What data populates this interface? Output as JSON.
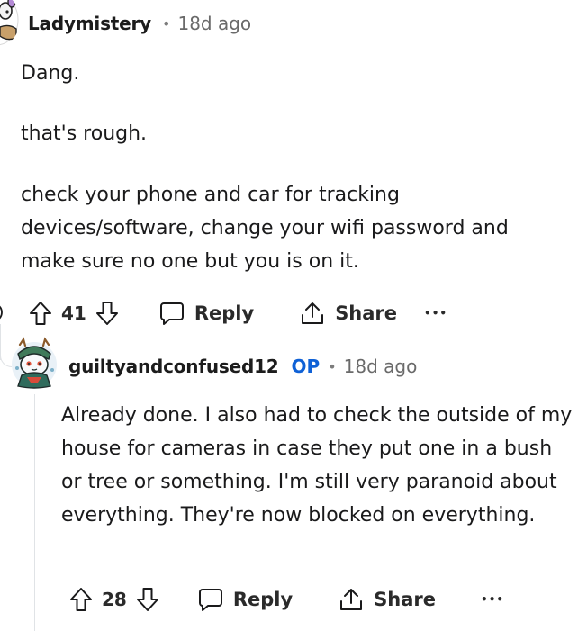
{
  "comment": {
    "author": "Ladymistery",
    "separator": "•",
    "time": "18d ago",
    "paragraphs": [
      "Dang.",
      "that's rough.",
      "check your phone and car for tracking devices/software, change your wifi password and make sure no one but you is on it."
    ],
    "votes": "41",
    "reply_label": "Reply",
    "share_label": "Share",
    "more_label": "•••"
  },
  "reply": {
    "author": "guiltyandconfused12",
    "op_badge": "OP",
    "separator": "•",
    "time": "18d ago",
    "body": "Already done. I also had to check the outside of my house for cameras in case they put one in a bush or tree or something. I'm still very paranoid about everything. They're now blocked on everything.",
    "votes": "28",
    "reply_label": "Reply",
    "share_label": "Share",
    "more_label": "•••"
  },
  "colors": {
    "text": "#1a1a1b",
    "meta": "#6a6a6a",
    "op": "#0f61d6",
    "thread_line": "#e0e3e6"
  },
  "icons": {
    "upvote": "arrow-up-icon",
    "downvote": "arrow-down-icon",
    "reply": "speech-bubble-icon",
    "share": "share-upload-icon",
    "more": "ellipsis-icon"
  }
}
